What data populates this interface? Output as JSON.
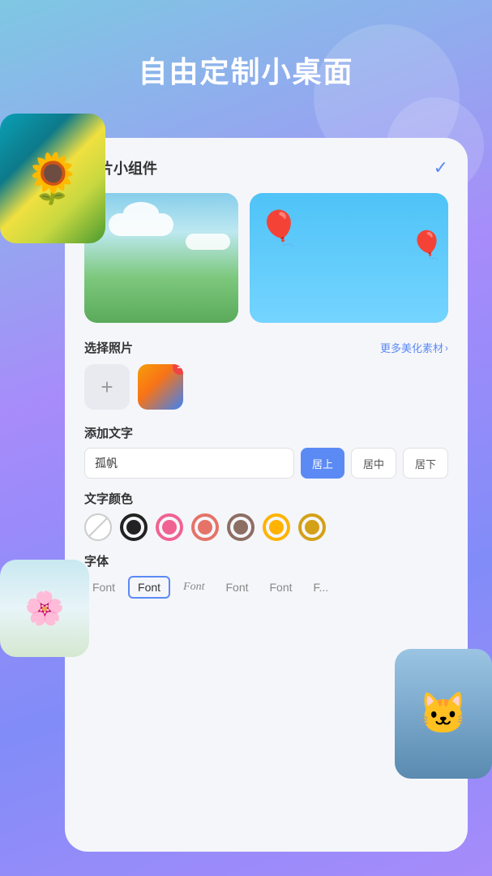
{
  "page": {
    "title": "自由定制小桌面",
    "background_gradient": "linear-gradient(160deg, #7ec8e3, #a78bfa, #818cf8)"
  },
  "card": {
    "title": "图片小组件",
    "check_icon": "✓"
  },
  "sections": {
    "select_photos": {
      "label": "选择照片",
      "link_text": "更多美化素材",
      "link_arrow": "›",
      "add_btn": "+"
    },
    "add_text": {
      "label": "添加文字",
      "input_value": "孤帆",
      "input_placeholder": "孤帆",
      "position_buttons": [
        {
          "label": "居上",
          "active": true
        },
        {
          "label": "居中",
          "active": false
        },
        {
          "label": "居下",
          "active": false
        }
      ]
    },
    "text_color": {
      "label": "文字颜色",
      "colors": [
        {
          "id": "none",
          "type": "none"
        },
        {
          "id": "black",
          "color": "#222222",
          "border_color": "#222222"
        },
        {
          "id": "pink",
          "color": "#f06292",
          "border_color": "#f06292"
        },
        {
          "id": "coral",
          "color": "#e57368",
          "border_color": "#e57368"
        },
        {
          "id": "brown",
          "color": "#8d6e63",
          "border_color": "#8d6e63"
        },
        {
          "id": "amber",
          "color": "#ffb300",
          "border_color": "#ffb300"
        },
        {
          "id": "gold",
          "color": "#d4a017",
          "border_color": "#d4a017"
        }
      ]
    },
    "font": {
      "label": "字体",
      "fonts": [
        {
          "label": "Font",
          "style": "normal",
          "active": false
        },
        {
          "label": "Font",
          "style": "normal",
          "active": true
        },
        {
          "label": "Font",
          "style": "italic",
          "active": false
        },
        {
          "label": "Font",
          "style": "normal",
          "active": false
        },
        {
          "label": "Font",
          "style": "normal",
          "active": false
        },
        {
          "label": "F...",
          "style": "normal",
          "active": false
        }
      ]
    }
  }
}
